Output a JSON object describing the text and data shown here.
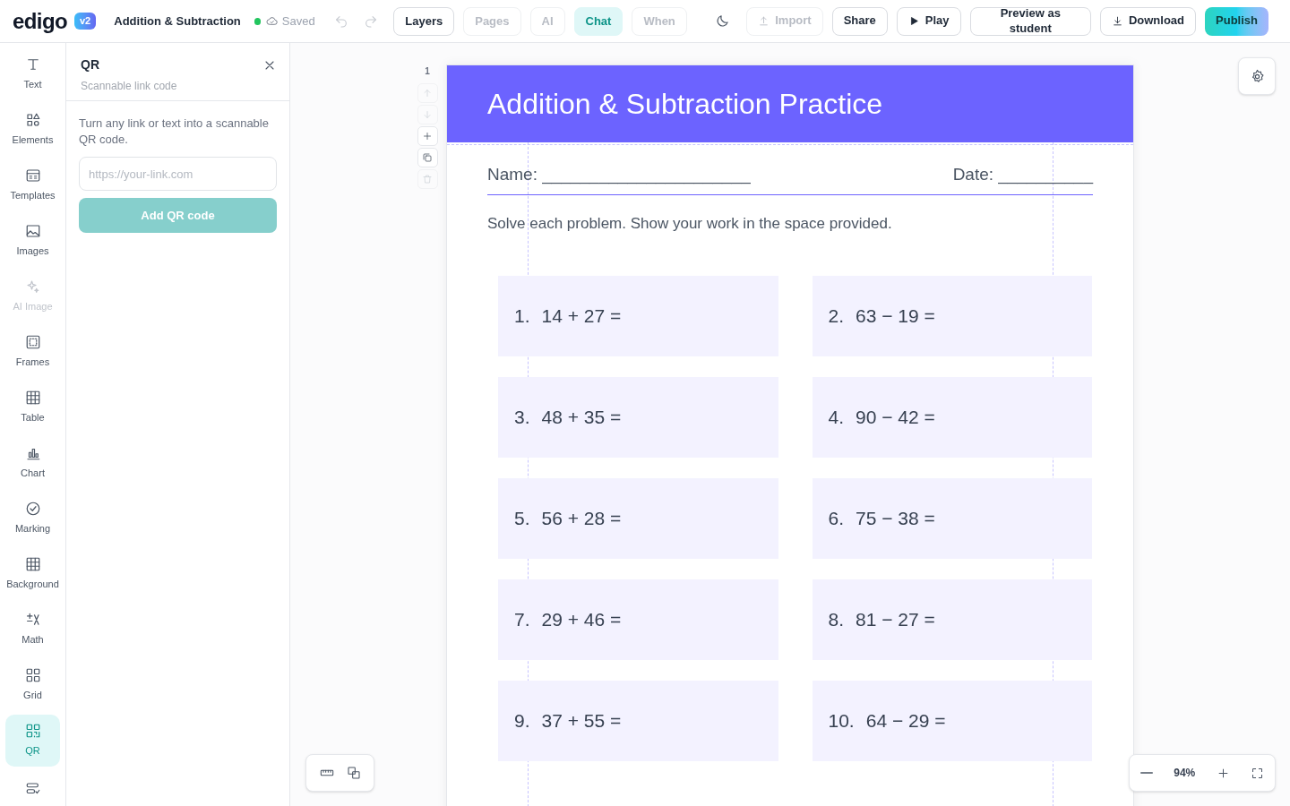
{
  "app": {
    "logo": "edigo",
    "version": "v2",
    "doc_title": "Addition & Subtraction",
    "save_status": "Saved"
  },
  "toolbar": [
    {
      "kind": "tab",
      "label": "Layers",
      "disabled": false,
      "selected": false
    },
    {
      "kind": "tab",
      "label": "Pages",
      "disabled": true,
      "selected": false
    },
    {
      "kind": "tab",
      "label": "AI",
      "disabled": true,
      "selected": false
    },
    {
      "kind": "tab",
      "label": "Chat",
      "disabled": false,
      "selected": true
    },
    {
      "kind": "tab",
      "label": "When",
      "disabled": true,
      "selected": false
    },
    {
      "kind": "theme"
    },
    {
      "kind": "button",
      "label": "Import",
      "disabled": true
    },
    {
      "kind": "button",
      "label": "Share",
      "disabled": false
    },
    {
      "kind": "button",
      "label": "Play",
      "disabled": false
    },
    {
      "kind": "button",
      "label": "Preview as student",
      "disabled": false
    },
    {
      "kind": "button",
      "label": "Download",
      "disabled": false
    },
    {
      "kind": "primary",
      "label": "Publish",
      "disabled": false
    }
  ],
  "sidebar": {
    "items": [
      {
        "label": "Text",
        "selected": false,
        "disabled": false
      },
      {
        "label": "Elements",
        "selected": false,
        "disabled": false
      },
      {
        "label": "Templates",
        "selected": false,
        "disabled": false
      },
      {
        "label": "Images",
        "selected": false,
        "disabled": false
      },
      {
        "label": "AI Image",
        "selected": false,
        "disabled": true
      },
      {
        "label": "Frames",
        "selected": false,
        "disabled": false
      },
      {
        "label": "Table",
        "selected": false,
        "disabled": false
      },
      {
        "label": "Chart",
        "selected": false,
        "disabled": false
      },
      {
        "label": "Marking",
        "selected": false,
        "disabled": false
      },
      {
        "label": "Background",
        "selected": false,
        "disabled": false
      },
      {
        "label": "Math",
        "selected": false,
        "disabled": false
      },
      {
        "label": "Grid",
        "selected": false,
        "disabled": false
      },
      {
        "label": "QR",
        "selected": true,
        "disabled": false
      },
      {
        "selected": false,
        "disabled": false
      }
    ]
  },
  "panel": {
    "title": "QR",
    "subtitle": "Scannable link code",
    "description": "Turn any link or text into a scannable QR code.",
    "input": {
      "placeholder": "https://your-link.com"
    },
    "button": {
      "label": "Add QR code",
      "disabled": true
    }
  },
  "page_controls": {
    "page_number": "1",
    "actions": [
      {
        "disabled": true
      },
      {
        "disabled": true
      },
      {
        "disabled": false
      },
      {
        "disabled": false
      },
      {
        "disabled": true
      }
    ]
  },
  "worksheet": {
    "title": "Addition & Subtraction Practice",
    "name_field": "Name: ______________________",
    "date_field": "Date: __________",
    "instructions": "Solve each problem. Show your work in the space provided.",
    "problems": [
      {
        "number": "1.",
        "expression": "14 + 27 ="
      },
      {
        "number": "2.",
        "expression": "63 − 19 ="
      },
      {
        "number": "3.",
        "expression": "48 + 35 ="
      },
      {
        "number": "4.",
        "expression": "90 − 42 ="
      },
      {
        "number": "5.",
        "expression": "56 + 28 ="
      },
      {
        "number": "6.",
        "expression": "75 − 38 ="
      },
      {
        "number": "7.",
        "expression": "29 + 46 ="
      },
      {
        "number": "8.",
        "expression": "81 − 27 ="
      },
      {
        "number": "9.",
        "expression": "37 + 55 ="
      },
      {
        "number": "10.",
        "expression": "64 − 29 ="
      }
    ]
  },
  "zoom": {
    "value": "94%"
  }
}
